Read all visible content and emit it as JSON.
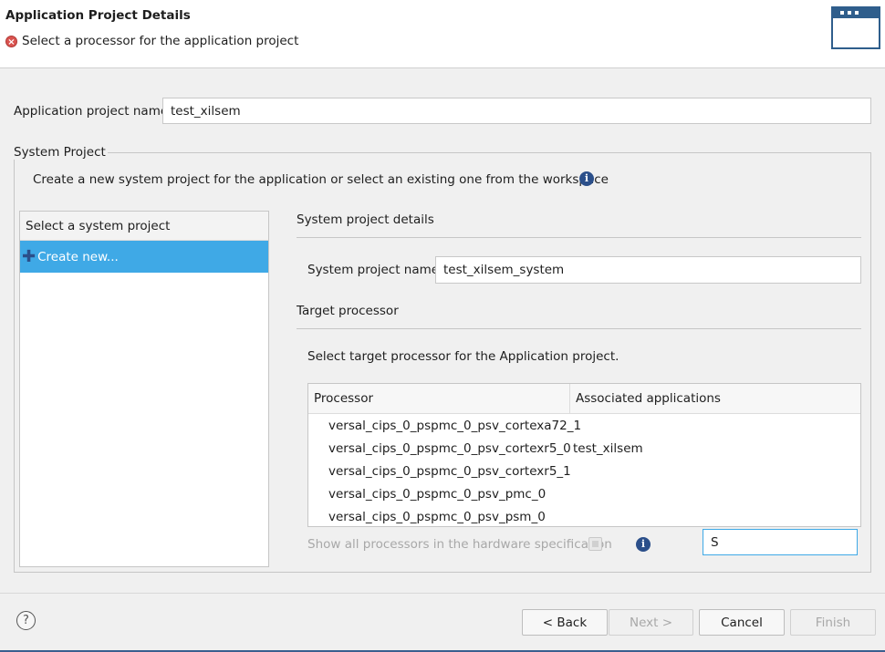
{
  "header": {
    "title": "Application Project Details",
    "message": "Select a processor for the application project",
    "message_icon": "error-icon"
  },
  "app_project": {
    "label": "Application project name:",
    "value": "test_xilsem"
  },
  "system_project": {
    "group_title": "System Project",
    "description": "Create a new system project for the application or select an existing one from the workspace",
    "list_header": "Select a system project",
    "list_items": [
      {
        "label": "Create new...",
        "icon": "plus-icon",
        "selected": true
      }
    ],
    "details_title": "System project details",
    "name_label": "System project name:",
    "name_value": "test_xilsem_system"
  },
  "target_processor": {
    "title": "Target processor",
    "instruction": "Select target processor for the Application project.",
    "columns": [
      "Processor",
      "Associated applications"
    ],
    "rows": [
      {
        "processor": "versal_cips_0_pspmc_0_psv_cortexa72_1",
        "apps": ""
      },
      {
        "processor": "versal_cips_0_pspmc_0_psv_cortexr5_0",
        "apps": "test_xilsem"
      },
      {
        "processor": "versal_cips_0_pspmc_0_psv_cortexr5_1",
        "apps": ""
      },
      {
        "processor": "versal_cips_0_pspmc_0_psv_pmc_0",
        "apps": ""
      },
      {
        "processor": "versal_cips_0_pspmc_0_psv_psm_0",
        "apps": ""
      }
    ],
    "show_all_label": "Show all processors in the hardware specification",
    "show_all_checked": false,
    "filter_value": "S"
  },
  "footer": {
    "back": "< Back",
    "next": "Next >",
    "cancel": "Cancel",
    "finish": "Finish"
  },
  "colors": {
    "selection": "#3fa9e6",
    "info_icon": "#2b4f8a",
    "error_icon": "#d9534f"
  }
}
